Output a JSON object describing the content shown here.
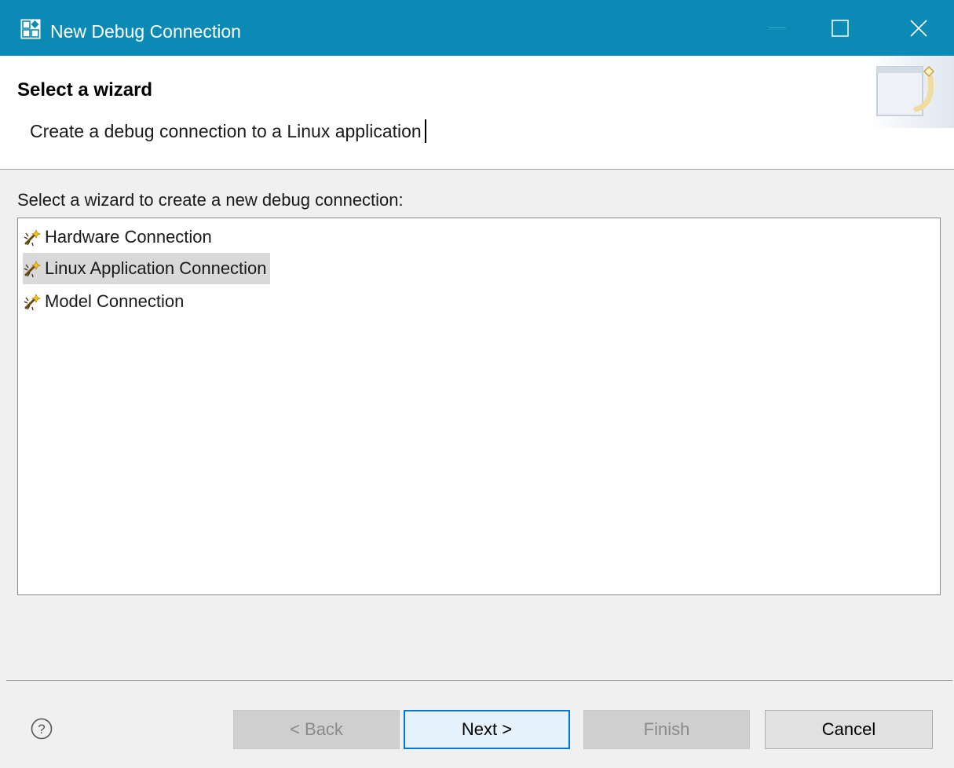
{
  "window": {
    "title": "New Debug Connection",
    "title_icon": "wizard-app-icon",
    "controls": [
      "minimize-icon",
      "maximize-icon",
      "close-icon"
    ],
    "accent_color": "#0b8ab5"
  },
  "header": {
    "title": "Select a wizard",
    "description": "Create a debug connection to a Linux application",
    "banner_icon": "new-wizard-banner-icon"
  },
  "main": {
    "prompt": "Select a wizard to create a new debug connection:",
    "items": [
      {
        "label": "Hardware Connection",
        "icon": "debug-connection-icon",
        "selected": false
      },
      {
        "label": "Linux Application Connection",
        "icon": "debug-connection-icon",
        "selected": true
      },
      {
        "label": "Model Connection",
        "icon": "debug-connection-icon",
        "selected": false
      }
    ]
  },
  "footer": {
    "help_icon": "help-icon",
    "back_label": "< Back",
    "next_label": "Next >",
    "finish_label": "Finish",
    "cancel_label": "Cancel",
    "back_enabled": false,
    "next_enabled": true,
    "finish_enabled": false,
    "cancel_enabled": true
  }
}
